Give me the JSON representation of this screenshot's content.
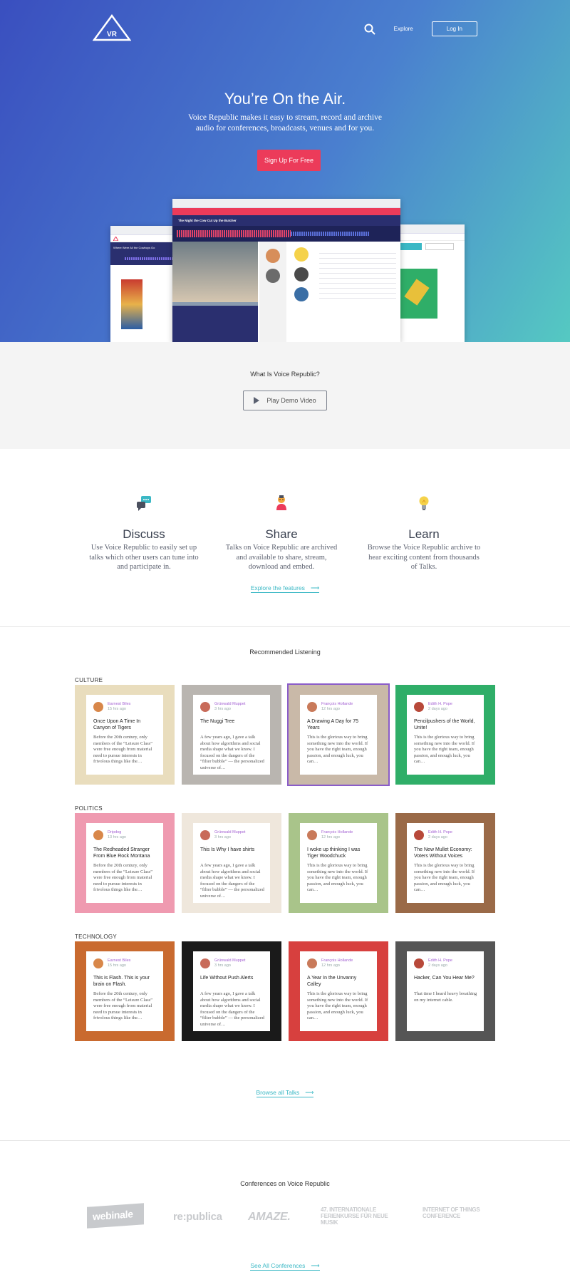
{
  "header": {
    "logo_text": "VR",
    "nav_explore": "Explore",
    "nav_login": "Log In"
  },
  "hero": {
    "title": "You’re On the Air.",
    "subtitle": "Voice Republic makes it easy to stream, record and archive audio for conferences, broadcasts, venues and for you.",
    "cta": "Sign Up For Free"
  },
  "mockup": {
    "center_title": "The Night the Cow Cut Up the Butcher",
    "left_title": "Where Were All the Cowboys Go"
  },
  "what_is": {
    "heading": "What Is Voice Republic?",
    "demo_button": "Play Demo Video"
  },
  "features": [
    {
      "title": "Discuss",
      "text": "Use Voice Republic to easily set up talks which other users can tune into and participate in.",
      "icon": "chat-icon"
    },
    {
      "title": "Share",
      "text": "Talks on Voice Republic are archived and available to share, stream, download and embed.",
      "icon": "person-icon"
    },
    {
      "title": "Learn",
      "text": "Browse the Voice Republic archive to hear exciting content from thousands of Talks.",
      "icon": "lightbulb-icon"
    }
  ],
  "explore_link": "Explore the features",
  "recommended": {
    "heading": "Recommended Listening",
    "browse_link": "Browse all Talks"
  },
  "categories": [
    {
      "name": "CULTURE",
      "cards": [
        {
          "author": "Earnest Biles",
          "time": "15 hrs ago",
          "title": "Once Upon A Time In Canyon of Tigers",
          "excerpt": "Before the 20th century, only members of the “Leisure Class” were free enough from material need to pursue interests in frivolous things like the…",
          "bg": "#e9ddbd"
        },
        {
          "author": "Grünwald Muppet",
          "time": "3 hrs ago",
          "title": "The Nuggi Tree",
          "excerpt": "A few years ago, I gave a talk about how algorithms and social media shape what we know. I focused on the dangers of the “filter bubble” — the personalized universe of…",
          "bg": "#b9b5b0"
        },
        {
          "author": "François Hollande",
          "time": "12 hrs ago",
          "title": "A Drawing A Day for 75 Years",
          "excerpt": "This is the glorious way to bring something new into the world. If you have the right team, enough passion, and enough luck, you can…",
          "bg": "#c9b9a8"
        },
        {
          "author": "Edith H. Pope",
          "time": "2 days ago",
          "title": "Pencilpushers of the World, Unite!",
          "excerpt": "This is the glorious way to bring something new into the world. If you have the right team, enough passion, and enough luck, you can…",
          "bg": "#2fae68"
        }
      ]
    },
    {
      "name": "POLITICS",
      "cards": [
        {
          "author": "Dripdog",
          "time": "13 hrs ago",
          "title": "The Redheaded Stranger From Blue Rock Montana",
          "excerpt": "Before the 20th century, only members of the “Leisure Class” were free enough from material need to pursue interests in frivolous things like the…",
          "bg": "#ef9ab0"
        },
        {
          "author": "Grünwald Muppet",
          "time": "3 hrs ago",
          "title": "This Is Why I have shirts",
          "excerpt": "A few years ago, I gave a talk about how algorithms and social media shape what we know. I focused on the dangers of the “filter bubble” — the personalized universe of…",
          "bg": "#efe7dc"
        },
        {
          "author": "François Hollande",
          "time": "12 hrs ago",
          "title": "I woke up thinking I was Tiger Woodchuck",
          "excerpt": "This is the glorious way to bring something new into the world. If you have the right team, enough passion, and enough luck, you can…",
          "bg": "#a9c48a"
        },
        {
          "author": "Edith H. Pope",
          "time": "2 days ago",
          "title": "The New Mullet Economy: Voters Without Voices",
          "excerpt": "This is the glorious way to bring something new into the world. If you have the right team, enough passion, and enough luck, you can…",
          "bg": "#9a6a48"
        }
      ]
    },
    {
      "name": "TECHNOLOGY",
      "cards": [
        {
          "author": "Earnest Biles",
          "time": "15 hrs ago",
          "title": "This is Flash. This is your brain on Flash.",
          "excerpt": "Before the 20th century, only members of the “Leisure Class” were free enough from material need to pursue interests in frivolous things like the…",
          "bg": "#c96a2f"
        },
        {
          "author": "Grünwald Muppet",
          "time": "3 hrs ago",
          "title": "Life Without Push Alerts",
          "excerpt": "A few years ago, I gave a talk about how algorithms and social media shape what we know. I focused on the dangers of the “filter bubble” — the personalized universe of…",
          "bg": "#1a1a1a"
        },
        {
          "author": "François Hollande",
          "time": "12 hrs ago",
          "title": "A Year In the Unvanny Calley",
          "excerpt": "This is the glorious way to bring something new into the world. If you have the right team, enough passion, and enough luck, you can…",
          "bg": "#d7403e"
        },
        {
          "author": "Edith H. Pope",
          "time": "2 days ago",
          "title": "Hacker, Can You Hear Me?",
          "excerpt": "That time I heard heavy breathing on my internet cable.",
          "bg": "#555555"
        }
      ]
    }
  ],
  "conferences": {
    "heading": "Conferences on Voice Republic",
    "logos": [
      "webinale",
      "re:publica",
      "AMAZE.",
      "47. INTERNATIONALE FERIENKURSE FÜR NEUE MUSIK",
      "INTERNET OF THINGS CONFERENCE"
    ],
    "link": "See All Conferences"
  }
}
